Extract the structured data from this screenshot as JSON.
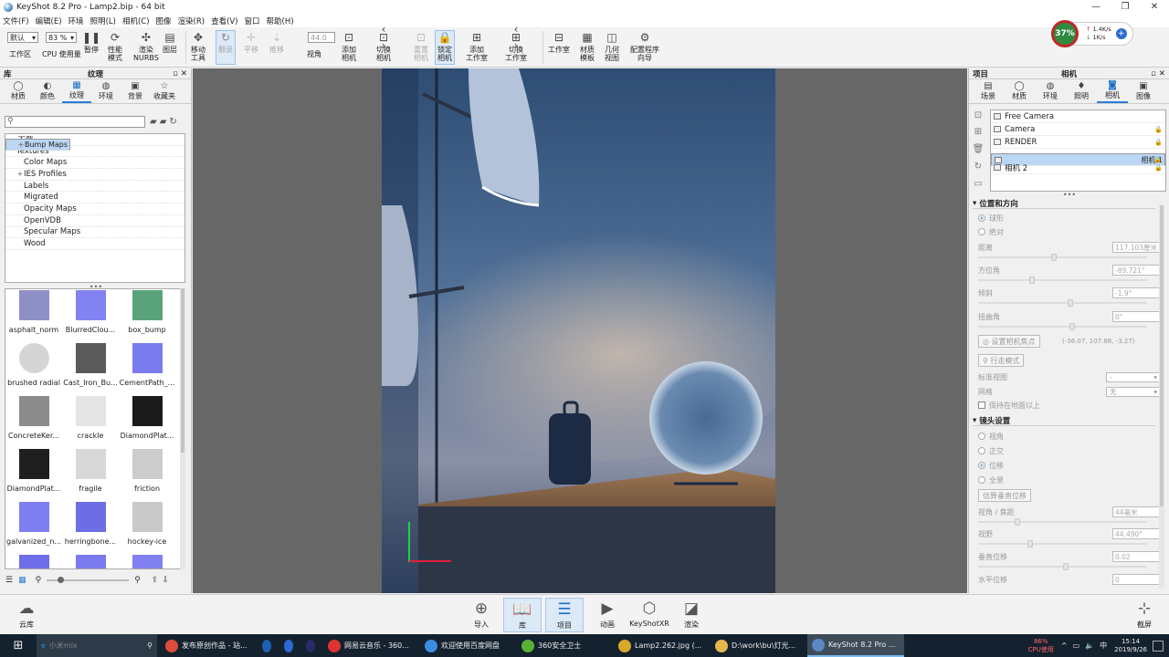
{
  "window": {
    "title": "KeyShot 8.2 Pro  - Lamp2.bip  - 64 bit",
    "minimize": "—",
    "maximize": "❐",
    "close": "✕"
  },
  "menu": [
    "文件(F)",
    "编辑(E)",
    "环境",
    "照明(L)",
    "相机(C)",
    "图像",
    "渲染(R)",
    "查看(V)",
    "窗口",
    "帮助(H)"
  ],
  "toolbar": {
    "workspace_value": "默认",
    "workspace_label": "工作区",
    "cpu_value": "83 %",
    "cpu_label": "CPU 使用量",
    "pause": "暂停",
    "perf_mode": "性能\n模式",
    "render_nurbs": "渲染\nNURBS",
    "layers": "图层",
    "move_tool": "移动\n工具",
    "refresh": "翻录",
    "pan": "平移",
    "dolly": "推移",
    "fov_value": "44.0",
    "fov_label": "视角",
    "add_camera": "添加\n相机",
    "switch_camera": "切换\n相机",
    "reset_camera": "重置\n相机",
    "lock_camera": "锁定\n相机",
    "add_studio": "添加\n工作室",
    "switch_studio": "切换\n工作室",
    "studio": "工作室",
    "material_template": "材质\n模板",
    "geometry_view": "几何\n视图",
    "config_wizard": "配置程序\n向导"
  },
  "netwidget": {
    "cpu": "37%",
    "up": "1.4K/s",
    "down": "1K/s"
  },
  "library": {
    "title": "纹理",
    "panel_label": "库",
    "tabs": [
      {
        "icon": "material-icon",
        "glyph": "◯",
        "label": "材质"
      },
      {
        "icon": "color-icon",
        "glyph": "◐",
        "label": "颜色"
      },
      {
        "icon": "texture-icon",
        "glyph": "▦",
        "label": "纹理",
        "active": true
      },
      {
        "icon": "environment-icon",
        "glyph": "◍",
        "label": "环境"
      },
      {
        "icon": "backplate-icon",
        "glyph": "▣",
        "label": "背景"
      },
      {
        "icon": "favorites-icon",
        "glyph": "☆",
        "label": "收藏夹"
      }
    ],
    "search_placeholder": "",
    "tree": [
      {
        "label": "下载",
        "indent": 0,
        "exp": ""
      },
      {
        "label": "Textures",
        "indent": 0,
        "exp": ""
      },
      {
        "label": "Bump Maps",
        "indent": 1,
        "exp": "+",
        "selected": true
      },
      {
        "label": "Color Maps",
        "indent": 1,
        "exp": ""
      },
      {
        "label": "IES Profiles",
        "indent": 1,
        "exp": "+"
      },
      {
        "label": "Labels",
        "indent": 1,
        "exp": ""
      },
      {
        "label": "Migrated",
        "indent": 1,
        "exp": ""
      },
      {
        "label": "Opacity Maps",
        "indent": 1,
        "exp": ""
      },
      {
        "label": "OpenVDB",
        "indent": 1,
        "exp": ""
      },
      {
        "label": "Specular Maps",
        "indent": 1,
        "exp": ""
      },
      {
        "label": "Wood",
        "indent": 1,
        "exp": ""
      }
    ],
    "thumbs": [
      {
        "label": "asphalt_norm",
        "color": "#8f8fc8"
      },
      {
        "label": "BlurredClou...",
        "color": "#8282f2"
      },
      {
        "label": "box_bump",
        "color": "#5aa37a"
      },
      {
        "label": "brushed radial",
        "color": "#d5d5d5"
      },
      {
        "label": "Cast_Iron_Bu...",
        "color": "#5a5a5a"
      },
      {
        "label": "CementPath_...",
        "color": "#7b7bf0"
      },
      {
        "label": "ConcreteKer...",
        "color": "#8c8c8c"
      },
      {
        "label": "crackle",
        "color": "#e5e5e5"
      },
      {
        "label": "DiamondPlat...",
        "color": "#1a1a1a"
      },
      {
        "label": "DiamondPlat...",
        "color": "#1f1f1f"
      },
      {
        "label": "fragile",
        "color": "#d8d8d8"
      },
      {
        "label": "friction",
        "color": "#cccccc"
      },
      {
        "label": "galvanized_n...",
        "color": "#7f7ff2"
      },
      {
        "label": "herringbone...",
        "color": "#6d6de4"
      },
      {
        "label": "hockey-ice",
        "color": "#c9c9c9"
      },
      {
        "label": "",
        "color": "#6e6ee8"
      },
      {
        "label": "",
        "color": "#7a7aee"
      },
      {
        "label": "",
        "color": "#8080f0"
      }
    ]
  },
  "project": {
    "panel_label": "项目",
    "title": "相机",
    "tabs": [
      {
        "icon": "scene-icon",
        "glyph": "▤",
        "label": "场景"
      },
      {
        "icon": "material-icon",
        "glyph": "◯",
        "label": "材质"
      },
      {
        "icon": "environment-icon",
        "glyph": "◍",
        "label": "环境"
      },
      {
        "icon": "lighting-icon",
        "glyph": "♦",
        "label": "照明"
      },
      {
        "icon": "camera-icon",
        "glyph": "◙",
        "label": "相机",
        "active": true
      },
      {
        "icon": "image-icon",
        "glyph": "▣",
        "label": "图像"
      }
    ],
    "cameras": [
      {
        "label": "Free Camera",
        "lock": false
      },
      {
        "label": "Camera",
        "lock": true
      },
      {
        "label": "RENDER",
        "lock": true
      },
      {
        "label": "相机 1",
        "lock": true,
        "selected": true
      },
      {
        "label": "相机 2",
        "lock": true
      }
    ],
    "pos_section": "位置和方向",
    "spherical": "球形",
    "absolute": "绝对",
    "distance_label": "距离",
    "distance_value": "117.103厘米",
    "azimuth_label": "方位角",
    "azimuth_value": "-89.721°",
    "incline_label": "倾斜",
    "incline_value": "-1.9°",
    "twist_label": "扭曲角",
    "twist_value": "0°",
    "set_focus_btn": "设置相机焦点",
    "focus_coords": "(-36.07, 107.88, -3.27)",
    "walk_btn": "行走模式",
    "std_view_label": "标准视图",
    "std_view_value": "-",
    "grid_label": "网格",
    "grid_value": "无",
    "keep_ground": "保持在地面以上",
    "lens_section": "镜头设置",
    "lens_opts": [
      "视角",
      "正交",
      "位移",
      "全景"
    ],
    "lens_selected": "位移",
    "estimate_btn": "估算垂直位移",
    "fov_focal_label": "视角 / 焦距",
    "fov_focal_value": "44毫米",
    "fov_label": "视野",
    "fov_value": "44.490°",
    "vshift_label": "垂直位移",
    "vshift_value": "0.02",
    "hshift_label": "水平位移",
    "hshift_value": "0"
  },
  "bottombar": {
    "cloud": "云库",
    "import": "导入",
    "library": "库",
    "project": "项目",
    "animation": "动画",
    "keyshotxr": "KeyShotXR",
    "render": "渲染",
    "screenshot": "截屏"
  },
  "taskbar": {
    "search_placeholder": "小米mix",
    "items": [
      {
        "label": "发布原创作品 - 站...",
        "color": "#dd4b39"
      },
      {
        "label": "",
        "color": "#1f5fb4"
      },
      {
        "label": "",
        "color": "#2a6ad1"
      },
      {
        "label": "",
        "color": "#2a2a6a"
      },
      {
        "label": "网易云音乐 - 360...",
        "color": "#d33"
      },
      {
        "label": "欢迎使用百度网盘",
        "color": "#3b8de0"
      },
      {
        "label": "360安全卫士",
        "color": "#5ab034"
      },
      {
        "label": "Lamp2.262.jpg (...",
        "color": "#d8a82a"
      },
      {
        "label": "D:\\work\\bu\\灯光...",
        "color": "#e5b84c"
      },
      {
        "label": "KeyShot 8.2 Pro ...",
        "color": "#5c88c4",
        "active": true
      }
    ],
    "cpu_pct": "86%",
    "cpu_label": "CPU使用",
    "time": "15:14",
    "date": "2019/9/26"
  },
  "colors": {
    "accent": "#2b7ed6",
    "render_bg": "#3a5c86"
  }
}
